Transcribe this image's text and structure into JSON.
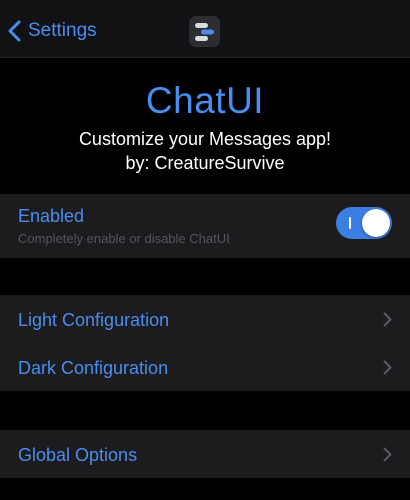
{
  "navbar": {
    "back_label": "Settings",
    "back_icon": "chevron-left-icon",
    "app_icon": "chatui-app-icon"
  },
  "header": {
    "title": "ChatUI",
    "tagline": "Customize your Messages app!",
    "author": "by: CreatureSurvive"
  },
  "enabled_section": {
    "title": "Enabled",
    "subtitle": "Completely enable or disable ChatUI",
    "toggle_on": true
  },
  "configuration_section": {
    "items": [
      {
        "label": "Light Configuration",
        "icon": "chevron-right-icon"
      },
      {
        "label": "Dark Configuration",
        "icon": "chevron-right-icon"
      }
    ]
  },
  "options_section": {
    "items": [
      {
        "label": "Global Options",
        "icon": "chevron-right-icon"
      }
    ]
  },
  "colors": {
    "accent": "#4a8df0",
    "toggle_on": "#3c7fe4",
    "background": "#000000",
    "cell_background": "#1c1c1e",
    "navbar_background": "#121214",
    "subtitle_text": "#55555a",
    "header_text": "#ffffff"
  }
}
